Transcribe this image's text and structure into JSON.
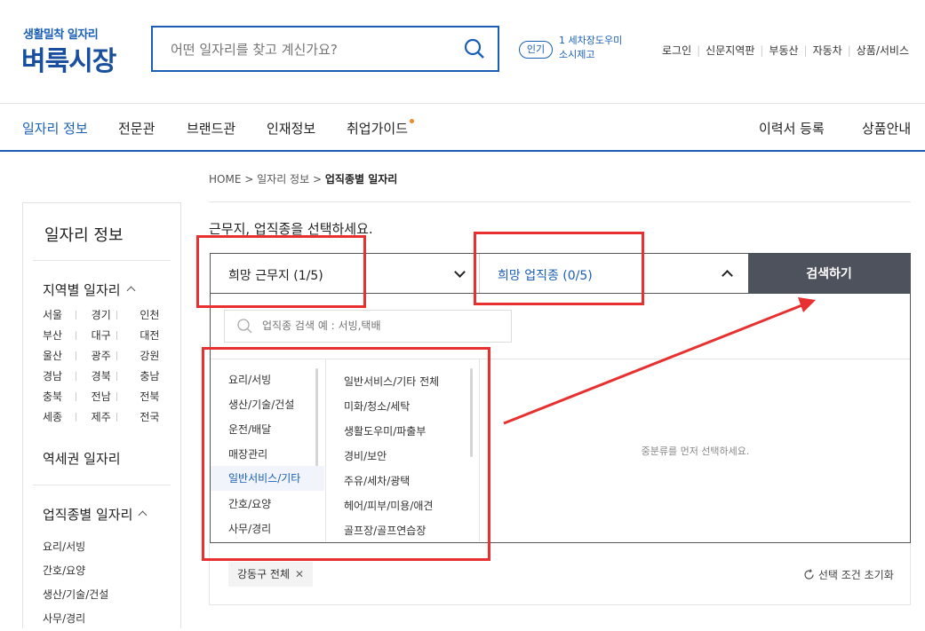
{
  "header": {
    "logo_sub": "생활밀착 일자리",
    "logo_main": "벼룩시장",
    "search_placeholder": "어떤 일자리를 찾고 계신가요?",
    "popular_badge": "인기",
    "popular_text": "1 세차장도우미\n소시제고",
    "util_links": [
      "로그인",
      "신문지역판",
      "부동산",
      "자동차",
      "상품/서비스"
    ]
  },
  "gnb": {
    "left": [
      "일자리 정보",
      "전문관",
      "브랜드관",
      "인재정보",
      "취업가이드"
    ],
    "right": [
      "이력서 등록",
      "상품안내"
    ]
  },
  "breadcrumb": {
    "home": "HOME",
    "sep": ">",
    "level1": "일자리 정보",
    "current": "업직종별 일자리"
  },
  "sidebar": {
    "title": "일자리 정보",
    "region_head": "지역별 일자리",
    "regions": [
      "서울",
      "경기",
      "인천",
      "부산",
      "대구",
      "대전",
      "울산",
      "광주",
      "강원",
      "경남",
      "경북",
      "충남",
      "충북",
      "전남",
      "전북",
      "세종",
      "제주",
      "전국"
    ],
    "station_head": "역세권 일자리",
    "job_head": "업직종별 일자리",
    "jobs": [
      "요리/서빙",
      "간호/요양",
      "생산/기술/건설",
      "사무/경리"
    ]
  },
  "main": {
    "title": "근무지, 업직종을 선택하세요.",
    "region_select": "희망 근무지 (1/5)",
    "job_select": "희망 업직종 (0/5)",
    "search_button": "검색하기",
    "job_search_placeholder": "업직종 검색 예 : 서빙,택배",
    "categories": [
      "요리/서빙",
      "생산/기술/건설",
      "운전/배달",
      "매장관리",
      "일반서비스/기타",
      "간호/요양",
      "사무/경리"
    ],
    "selected_category_index": 4,
    "subcategories": [
      "일반서비스/기타 전체",
      "미화/청소/세탁",
      "생활도우미/파출부",
      "경비/보안",
      "주유/세차/광택",
      "헤어/피부/미용/애견",
      "골프장/골프연습장"
    ],
    "empty_message": "중분류를 먼저 선택하세요.",
    "selected_chip": "강동구 전체",
    "reset_label": "선택 조건 초기화"
  },
  "colors": {
    "brand": "#1a5fb4",
    "annotation": "#e83030",
    "button": "#4d525c",
    "accent_dot": "#f08a24"
  }
}
